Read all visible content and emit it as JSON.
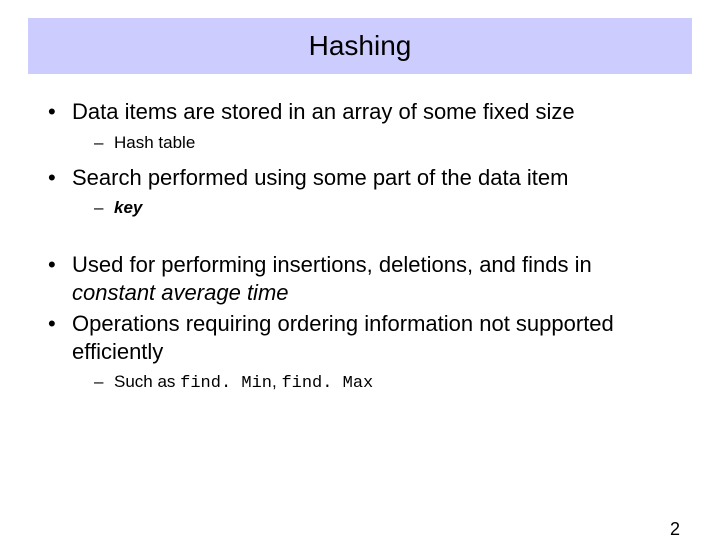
{
  "title": "Hashing",
  "bullets": {
    "b1": {
      "text_a": "Data items are stored in an ",
      "text_b": "array",
      "text_c": " of some fixed size",
      "sub": "Hash table"
    },
    "b2": {
      "text": "Search performed using some part of the data item",
      "sub_prefix": "",
      "sub_bold_italic": "key"
    },
    "b3": {
      "text_a": "Used for performing insertions, deletions, and finds in ",
      "text_b": "constant",
      "text_c": " ",
      "text_d": "average",
      "text_e": " ",
      "text_f": "time"
    },
    "b4": {
      "text_a": "Operations requiring ",
      "text_b": "ordering",
      "text_c": " information not supported efficiently",
      "sub_prefix": "Such as ",
      "sub_code1": "find. Min",
      "sub_mid": ", ",
      "sub_code2": "find. Max"
    }
  },
  "page_number": "2"
}
